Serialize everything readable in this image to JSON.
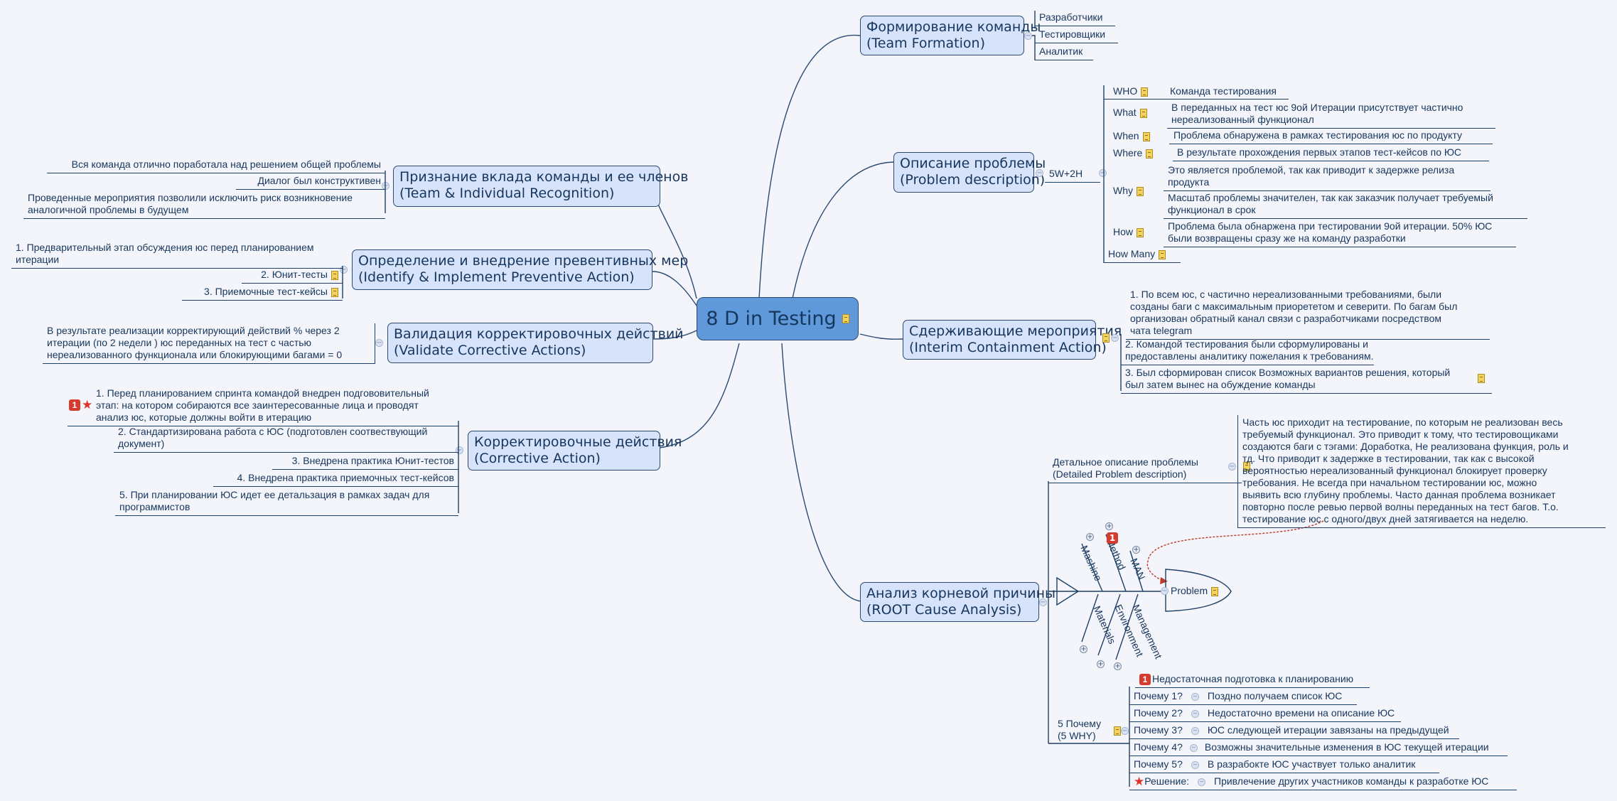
{
  "central": {
    "title": "8 D in Testing",
    "icon": "note-icon"
  },
  "topics": {
    "team_formation": {
      "line1": "Формирование команды",
      "line2": "(Team Formation)",
      "children": [
        "Разработчики",
        "Тестировщики",
        "Аналитик"
      ]
    },
    "problem_description": {
      "line1": "Описание проблемы",
      "line2": "(Problem description)",
      "sub": "5W+2H",
      "items": [
        {
          "key": "WHO",
          "text": [
            "Команда тестирования"
          ]
        },
        {
          "key": "What",
          "text": [
            "В переданных на тест юс 9ой Итерации присутствует частично",
            "нереализованный функционал"
          ]
        },
        {
          "key": "When",
          "text": [
            "Проблема обнаружена в рамках  тестирования юс по продукту"
          ]
        },
        {
          "key": "Where",
          "text": [
            "В результате прохождения первых этапов тест-кейсов по ЮС"
          ]
        },
        {
          "key": "Why",
          "text": [
            "Это является проблемой, так как приводит к задержке релиза",
            "продукта"
          ],
          "text2": [
            "Масштаб проблемы значителен, так как заказчик получает требуемый",
            "функционал в срок"
          ]
        },
        {
          "key": "How",
          "text": [
            "Проблема была обнаржена при тестировании 9ой итерации. 50% ЮС",
            "были возвращены сразу же на команду разработки"
          ]
        },
        {
          "key": "How Many",
          "text": []
        }
      ]
    },
    "containment": {
      "line1": "Сдерживающие мероприятия",
      "line2": "(Interim Containment Action)",
      "items": [
        [
          "1. По всем юс, с частично нереализованными требованиями, были",
          "созданы баги с максимальным приорететом и северити. По багам был",
          "организован обратный канал связи с разработчиками посредством",
          "чата telegram"
        ],
        [
          "2. Командой тестирования были сформулированы и",
          "предоставлены аналитику пожелания к требованиям."
        ],
        [
          "3. Был сформирован список Возможных вариантов решения, который",
          "был затем вынес на обуждение команды"
        ]
      ]
    },
    "root_cause": {
      "line1": "Анализ корневой причины",
      "line2": "(ROOT Cause Analysis)",
      "detailed_label": [
        "Детальное описание проблемы",
        "(Detailed Problem description)"
      ],
      "detailed_text": [
        "Часть юс приходит на тестирование, по которым не реализован весь",
        "требуемый функционал. Это приводит к тому, что тестировощиками",
        "создаются баги с тэгами: Доработка, Не реализована функция, роль и",
        "тд. Что приводит к задержке в тестировании, так как с высокой",
        "вероятностью нереализованный функционал блокирует проверку",
        "требования. Не всегда при начальном тестировании юс, можно",
        "выявить всю глубину проблемы. Часто данная проблема возникает",
        "повторно после ревью первой волны переданных на тест багов. Т.о.",
        "тестирование юс с одного/двух дней затягивается на неделю."
      ],
      "fishbone": {
        "head": "Problem",
        "top": [
          "Mashine",
          "Method",
          "MAN"
        ],
        "bottom": [
          "Materials",
          "Environment",
          "Management"
        ],
        "method_priority": "1"
      },
      "five_why_label": [
        "5 Почему",
        "(5 WHY)"
      ],
      "five_why_head": {
        "priority": "1",
        "text": "Недостаточная подготовка к планированию"
      },
      "five_why": [
        {
          "q": "Почему 1?",
          "a": "Поздно получаем список ЮС"
        },
        {
          "q": "Почему 2?",
          "a": "Недостаточно времени на описание ЮС"
        },
        {
          "q": "Почему 3?",
          "a": "ЮС следующей итерации завязаны на предыдущей"
        },
        {
          "q": "Почему 4?",
          "a": "Возможны значительные изменения в ЮС текущей итерации"
        },
        {
          "q": "Почему 5?",
          "a": "В разрабокте ЮС участвует только аналитик"
        },
        {
          "q": "Решение:",
          "a": "Привлечение других участников команды к разработке ЮС"
        }
      ]
    },
    "recognition": {
      "line1": "Признание вклада команды и ее членов",
      "line2": "(Team & Individual Recognition)",
      "items": [
        [
          "Вся команда отлично поработала над решением общей проблемы"
        ],
        [
          "Диалог был конструктивен"
        ],
        [
          "Проведенные мероприятия позволили исключить риск возникновение",
          "аналогичной проблемы в будущем"
        ]
      ]
    },
    "preventive": {
      "line1": "Определение и внедрение превентивных мер",
      "line2": "(Identify & Implement Preventive Action)",
      "items": [
        [
          "1. Предварительный этап обсуждения юс перед планированием",
          "итерации"
        ],
        [
          "2. Юнит-тесты"
        ],
        [
          "3. Приемочные тест-кейсы"
        ]
      ]
    },
    "validate": {
      "line1": "Валидация корректировочных действий",
      "line2": "(Validate Corrective Actions)",
      "items": [
        [
          "В результате реализации  корректирующий действий % через 2",
          "итерации (по 2 недели ) юс переданных на тест с частью",
          "нереализованного функционала или блокирующими багами = 0"
        ]
      ]
    },
    "corrective": {
      "line1": "Корректировочные действия",
      "line2": "(Corrective Action)",
      "items": [
        [
          "1. Перед планированием спринта командой внедрен подгововительный",
          "этап: на котором собираются все заинтересованные лица и проводят",
          "анализ юс, которые должны войти в итерацию"
        ],
        [
          "2. Стандартизирована работа с ЮС (подготовлен соотвествующий",
          "документ)"
        ],
        [
          "3. Внедрена практика Юнит-тестов"
        ],
        [
          "4. Внедрена практика приемочных тест-кейсов"
        ],
        [
          "5. При планировании ЮС идет ее детальзация в рамках задач для",
          "программистов"
        ]
      ],
      "first_priority": "1"
    }
  },
  "colors": {
    "background": "#f3f5fa",
    "topic_fill": "#d6e3fb",
    "central_fill": "#5f99d9",
    "line": "#1e3f66",
    "relationship": "#c0392b"
  }
}
